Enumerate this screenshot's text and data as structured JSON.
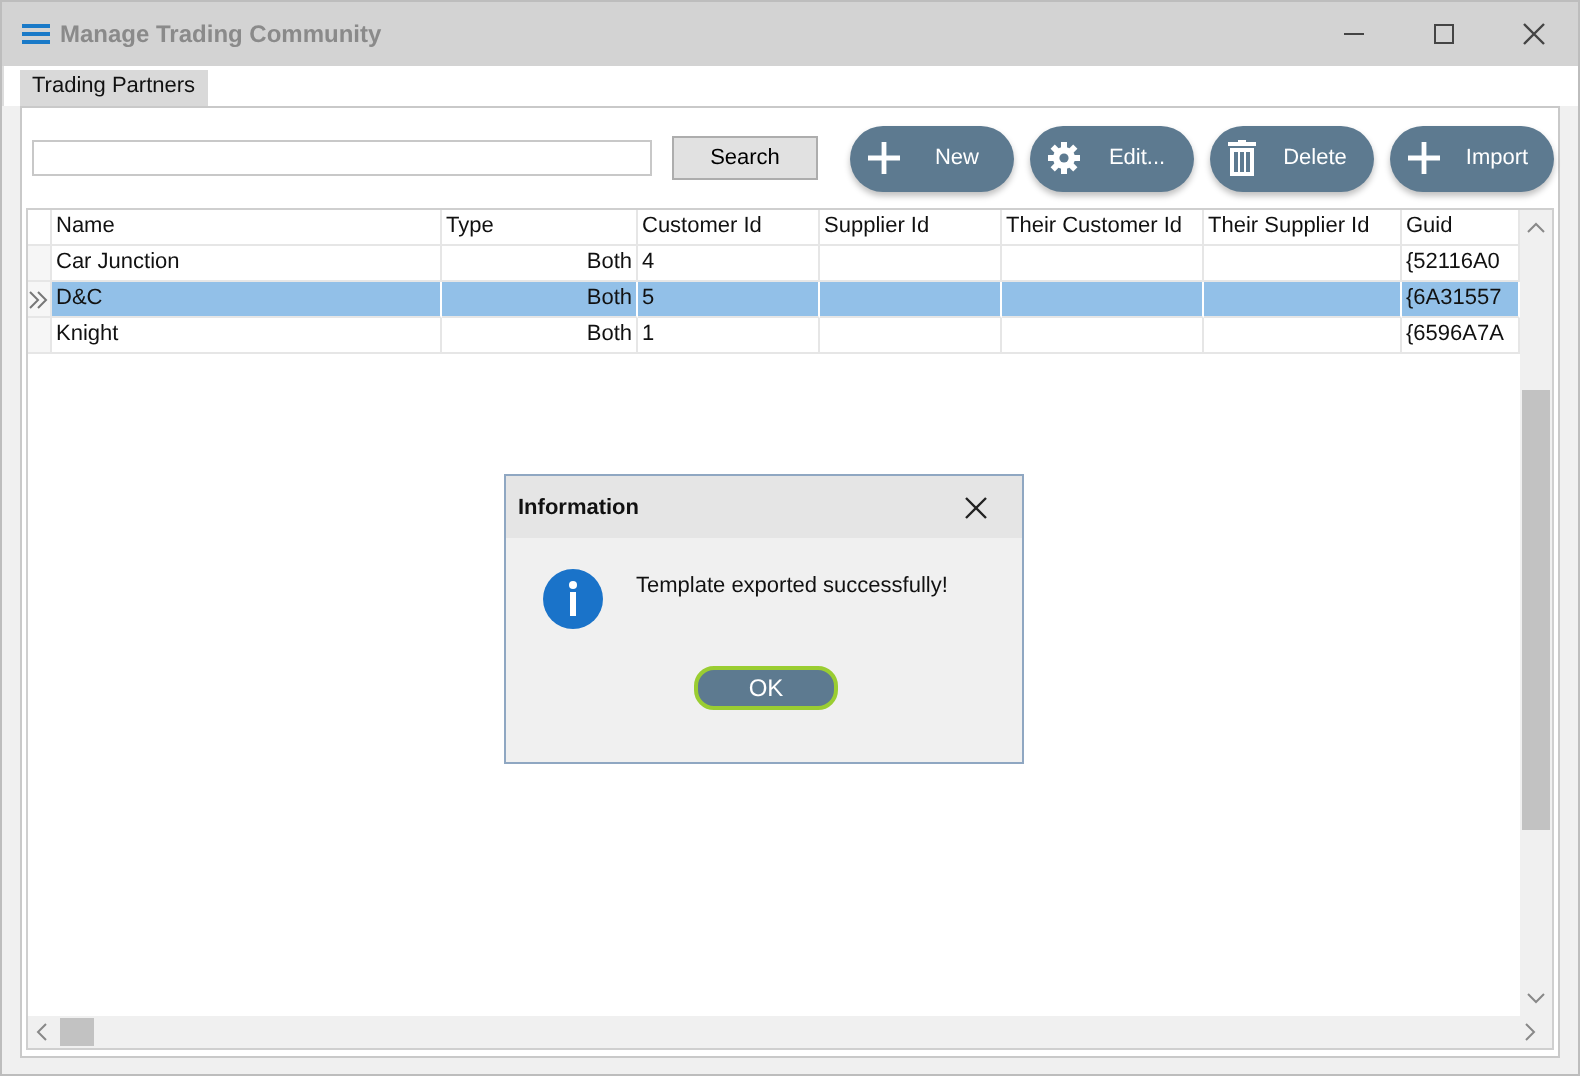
{
  "window": {
    "title": "Manage Trading Community"
  },
  "tabs": [
    {
      "label": "Trading Partners",
      "selected": true
    }
  ],
  "search": {
    "button": "Search"
  },
  "toolbar": [
    {
      "kind": "plus",
      "label": "New"
    },
    {
      "kind": "gear",
      "label": "Edit..."
    },
    {
      "kind": "trash",
      "label": "Delete"
    },
    {
      "kind": "plus",
      "label": "Import"
    }
  ],
  "table": {
    "columns": [
      "Name",
      "Type",
      "Customer Id",
      "Supplier Id",
      "Their Customer Id",
      "Their Supplier Id",
      "Guid"
    ],
    "rows": [
      {
        "selected": false,
        "cells": [
          "Car Junction",
          "Both",
          "4",
          "",
          "",
          "",
          "{52116A0"
        ]
      },
      {
        "selected": true,
        "cells": [
          "D&C",
          "Both",
          "5",
          "",
          "",
          "",
          "{6A31557"
        ]
      },
      {
        "selected": false,
        "cells": [
          "Knight",
          "Both",
          "1",
          "",
          "",
          "",
          "{6596A7A"
        ]
      }
    ]
  },
  "dialog": {
    "title": "Information",
    "message": "Template exported successfully!",
    "button": "OK"
  }
}
